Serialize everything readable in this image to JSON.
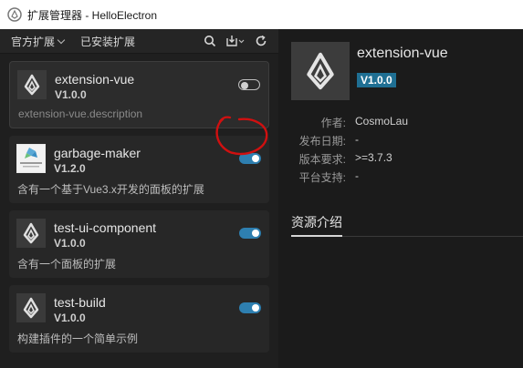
{
  "window": {
    "title": "扩展管理器 - HelloElectron"
  },
  "toolbar": {
    "tabs": [
      {
        "label": "官方扩展",
        "has_dropdown": true
      },
      {
        "label": "已安装扩展",
        "has_dropdown": false
      }
    ],
    "icons": [
      "search-icon",
      "import-icon",
      "refresh-icon"
    ]
  },
  "extensions": [
    {
      "name": "extension-vue",
      "version": "V1.0.0",
      "description": "extension-vue.description",
      "enabled": false,
      "selected": true
    },
    {
      "name": "garbage-maker",
      "version": "V1.2.0",
      "description": "含有一个基于Vue3.x开发的面板的扩展",
      "enabled": true,
      "selected": false
    },
    {
      "name": "test-ui-component",
      "version": "V1.0.0",
      "description": "含有一个面板的扩展",
      "enabled": true,
      "selected": false
    },
    {
      "name": "test-build",
      "version": "V1.0.0",
      "description": "构建插件的一个简单示例",
      "enabled": true,
      "selected": false
    }
  ],
  "detail": {
    "name": "extension-vue",
    "version": "V1.0.0",
    "meta": [
      {
        "label": "作者:",
        "value": "CosmoLau"
      },
      {
        "label": "发布日期:",
        "value": "-"
      },
      {
        "label": "版本要求:",
        "value": ">=3.7.3"
      },
      {
        "label": "平台支持:",
        "value": "-"
      }
    ],
    "tab": "资源介绍"
  },
  "colors": {
    "accent": "#2e7fb0",
    "badge": "#1f6f93",
    "annotation": "#d01010"
  }
}
